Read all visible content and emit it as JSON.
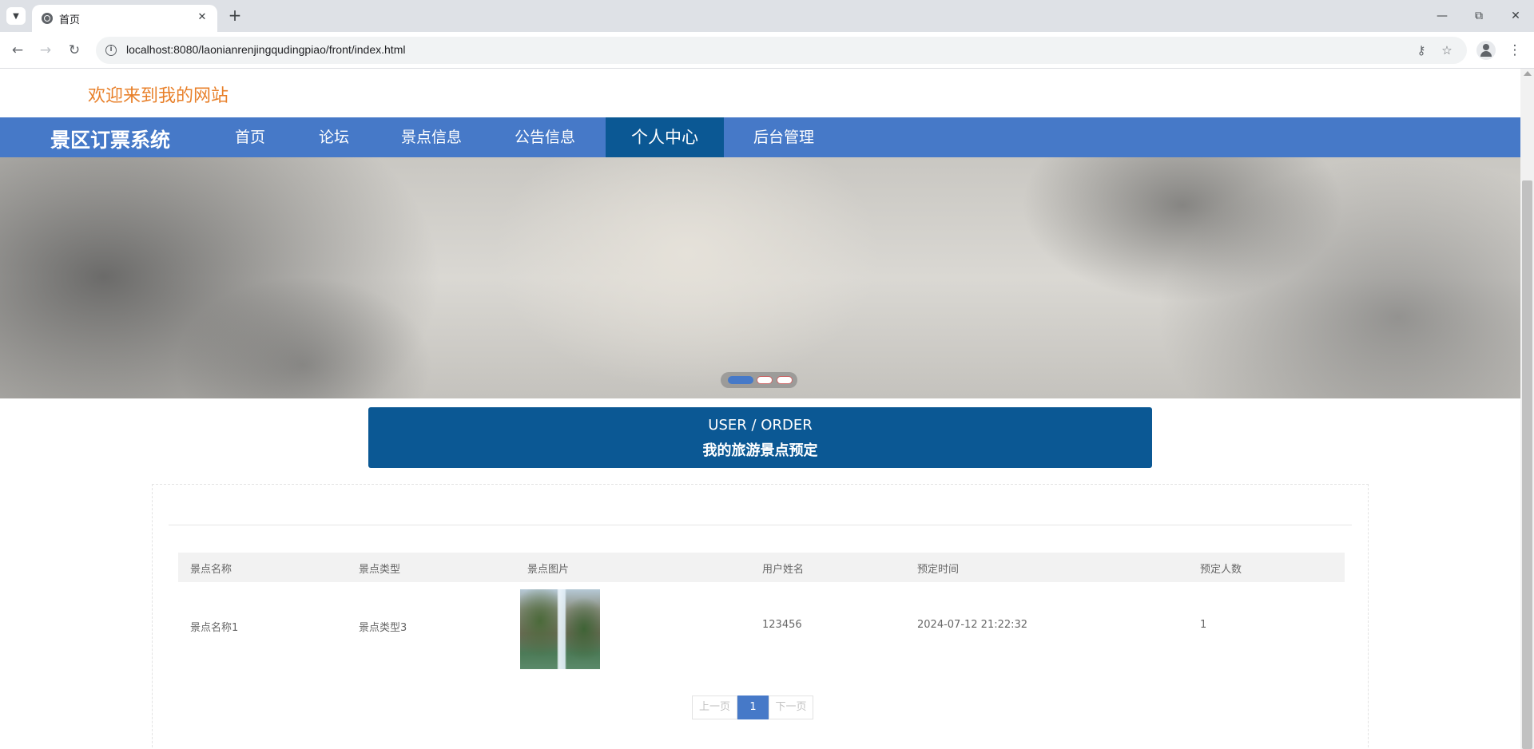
{
  "browser": {
    "tab_title": "首页",
    "url": "localhost:8080/laonianrenjingqudingpiao/front/index.html"
  },
  "site": {
    "welcome": "欢迎来到我的网站",
    "brand": "景区订票系统",
    "nav": [
      {
        "label": "首页",
        "active": false
      },
      {
        "label": "论坛",
        "active": false
      },
      {
        "label": "景点信息",
        "active": false
      },
      {
        "label": "公告信息",
        "active": false
      },
      {
        "label": "个人中心",
        "active": true
      },
      {
        "label": "后台管理",
        "active": false
      }
    ],
    "carousel": {
      "slides": 3,
      "active_index": 0
    }
  },
  "section": {
    "title_en": "USER / ORDER",
    "title_cn": "我的旅游景点预定"
  },
  "table": {
    "headers": [
      "景点名称",
      "景点类型",
      "景点图片",
      "用户姓名",
      "预定时间",
      "预定人数"
    ],
    "rows": [
      {
        "name": "景点名称1",
        "type": "景点类型3",
        "image": "waterfall-photo",
        "user": "123456",
        "time": "2024-07-12 21:22:32",
        "count": "1"
      }
    ]
  },
  "pagination": {
    "prev": "上一页",
    "current": "1",
    "next": "下一页"
  },
  "colors": {
    "welcome": "#e8802a",
    "navbar": "#4679c8",
    "nav_active": "#0b5894",
    "title_box": "#0b5894"
  }
}
